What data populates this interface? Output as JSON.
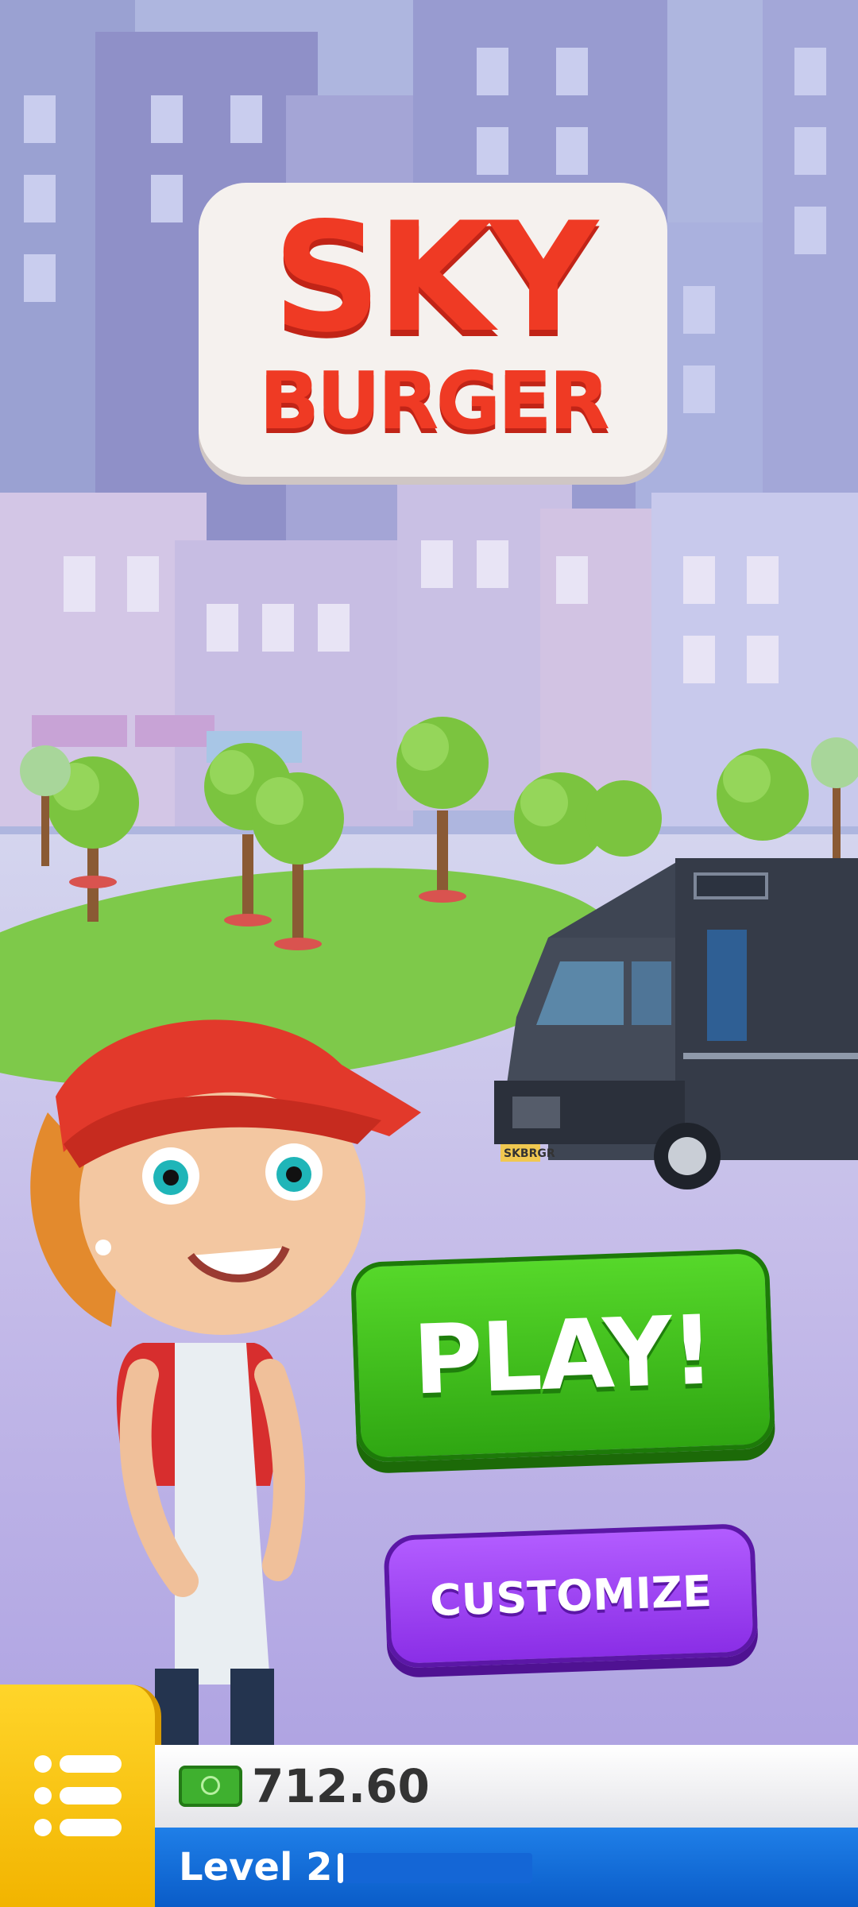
{
  "logo": {
    "line1": "SKY",
    "line2": "BURGER"
  },
  "truck": {
    "plate": "SKBRGR"
  },
  "buttons": {
    "play_label": "PLAY!",
    "customize_label": "CUSTOMIZE"
  },
  "hud": {
    "menu_icon": "menu-list-icon",
    "money_icon": "cash-icon",
    "money": "712.60",
    "level_label": "Level 2",
    "level_progress": 0.03
  },
  "colors": {
    "play": "#3cc11b",
    "customize": "#9b3ef2",
    "menu": "#f7c30d",
    "level_bar": "#1a73e0"
  }
}
